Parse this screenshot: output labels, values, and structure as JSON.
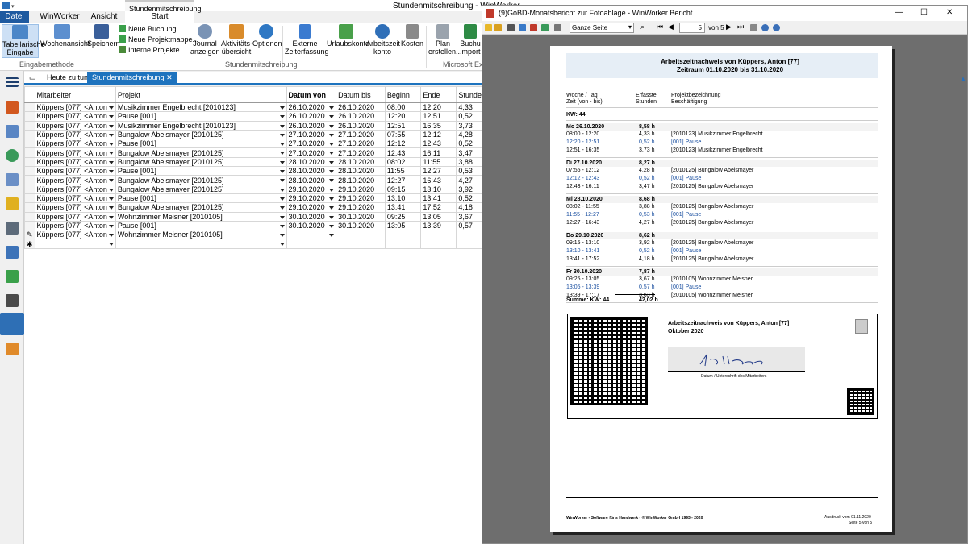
{
  "app": {
    "window_title": "Stundenmitschreibung - WinWorker",
    "context_group": "Stundenmitschreibung",
    "tabs": [
      "Datei",
      "WinWorker",
      "Ansicht",
      "Start"
    ]
  },
  "ribbon": {
    "buttons": {
      "tabellarische": "Tabellarische Eingabe",
      "wochenansicht": "Wochenansicht",
      "speichern": "Speichern",
      "neue_buchung": "Neue Buchung...",
      "neue_projektmappe": "Neue Projektmappe...",
      "interne_projekte": "Interne Projekte",
      "journal": "Journal anzeigen",
      "aktivitaeten": "Aktivitäts-übersicht",
      "optionen": "Optionen",
      "externe": "Externe Zeiterfassung",
      "urlaubskonto": "Urlaubskonto",
      "arbeitszeitkonto": "Arbeitszeit-konto",
      "kosten": "Kosten",
      "plan": "Plan erstellen...",
      "buchu": "Buchu import"
    },
    "groups": {
      "eingabemethode": "Eingabemethode",
      "stundenmitschreibung": "Stundenmitschreibung",
      "excel": "Microsoft Exc"
    }
  },
  "doc_tabs": [
    "Heute zu tun",
    "Stundenmitschreibung"
  ],
  "grid": {
    "columns": [
      "Mitarbeiter",
      "Projekt",
      "Datum von",
      "Datum bis",
      "Beginn",
      "Ende",
      "Stunde"
    ],
    "rows": [
      [
        "Küppers [077] <Anton",
        "Musikzimmer Engelbrecht [2010123]",
        "26.10.2020",
        "26.10.2020",
        "08:00",
        "12:20",
        "4,33"
      ],
      [
        "Küppers [077] <Anton",
        "Pause [001]",
        "26.10.2020",
        "26.10.2020",
        "12:20",
        "12:51",
        "0,52"
      ],
      [
        "Küppers [077] <Anton",
        "Musikzimmer Engelbrecht [2010123]",
        "26.10.2020",
        "26.10.2020",
        "12:51",
        "16:35",
        "3,73"
      ],
      [
        "Küppers [077] <Anton",
        "Bungalow Abelsmayer [2010125]",
        "27.10.2020",
        "27.10.2020",
        "07:55",
        "12:12",
        "4,28"
      ],
      [
        "Küppers [077] <Anton",
        "Pause [001]",
        "27.10.2020",
        "27.10.2020",
        "12:12",
        "12:43",
        "0,52"
      ],
      [
        "Küppers [077] <Anton",
        "Bungalow Abelsmayer [2010125]",
        "27.10.2020",
        "27.10.2020",
        "12:43",
        "16:11",
        "3,47"
      ],
      [
        "Küppers [077] <Anton",
        "Bungalow Abelsmayer [2010125]",
        "28.10.2020",
        "28.10.2020",
        "08:02",
        "11:55",
        "3,88"
      ],
      [
        "Küppers [077] <Anton",
        "Pause [001]",
        "28.10.2020",
        "28.10.2020",
        "11:55",
        "12:27",
        "0,53"
      ],
      [
        "Küppers [077] <Anton",
        "Bungalow Abelsmayer [2010125]",
        "28.10.2020",
        "28.10.2020",
        "12:27",
        "16:43",
        "4,27"
      ],
      [
        "Küppers [077] <Anton",
        "Bungalow Abelsmayer [2010125]",
        "29.10.2020",
        "29.10.2020",
        "09:15",
        "13:10",
        "3,92"
      ],
      [
        "Küppers [077] <Anton",
        "Pause [001]",
        "29.10.2020",
        "29.10.2020",
        "13:10",
        "13:41",
        "0,52"
      ],
      [
        "Küppers [077] <Anton",
        "Bungalow Abelsmayer [2010125]",
        "29.10.2020",
        "29.10.2020",
        "13:41",
        "17:52",
        "4,18"
      ],
      [
        "Küppers [077] <Anton",
        "Wohnzimmer Meisner [2010105]",
        "30.10.2020",
        "30.10.2020",
        "09:25",
        "13:05",
        "3,67"
      ],
      [
        "Küppers [077] <Anton",
        "Pause [001]",
        "30.10.2020",
        "30.10.2020",
        "13:05",
        "13:39",
        "0,57"
      ],
      [
        "Küppers [077] <Anton",
        "Wohnzimmer Meisner [2010105]",
        "",
        "",
        "",
        "",
        ""
      ]
    ]
  },
  "report_window": {
    "title": "(9)GoBD-Monatsbericht zur Fotoablage - WinWorker Bericht",
    "zoom": "Ganze Seite",
    "page_input": "5",
    "page_of": "von 5",
    "heading1": "Arbeitszeitnachweis von Küppers, Anton [77]",
    "heading2": "Zeitraum  01.10.2020  bis 31.10.2020",
    "col_woche": "Woche / Tag",
    "col_zeit": "Zeit (von - bis)",
    "col_erfasste": "Erfasste",
    "col_stunden": "Stunden",
    "col_projekt": "Projektbezeichnung",
    "col_besch": "Beschäftigung",
    "kw": "KW: 44",
    "days": [
      {
        "label": "Mo  26.10.2020",
        "total": "8,58 h",
        "entries": [
          {
            "time": "08:00 - 12:20",
            "hours": "4,33 h",
            "project": "[2010123] Musikzimmer Engelbrecht",
            "pause": false
          },
          {
            "time": "12:20 - 12:51",
            "hours": "0,52 h",
            "project": "[001] Pause",
            "pause": true
          },
          {
            "time": "12:51 - 16:35",
            "hours": "3,73 h",
            "project": "[2010123] Musikzimmer Engelbrecht",
            "pause": false
          }
        ]
      },
      {
        "label": "Di  27.10.2020",
        "total": "8,27 h",
        "entries": [
          {
            "time": "07:55 - 12:12",
            "hours": "4,28 h",
            "project": "[2010125] Bungalow Abelsmayer",
            "pause": false
          },
          {
            "time": "12:12 - 12:43",
            "hours": "0,52 h",
            "project": "[001] Pause",
            "pause": true
          },
          {
            "time": "12:43 - 16:11",
            "hours": "3,47 h",
            "project": "[2010125] Bungalow Abelsmayer",
            "pause": false
          }
        ]
      },
      {
        "label": "Mi  28.10.2020",
        "total": "8,68 h",
        "entries": [
          {
            "time": "08:02 - 11:55",
            "hours": "3,88 h",
            "project": "[2010125] Bungalow Abelsmayer",
            "pause": false
          },
          {
            "time": "11:55 - 12:27",
            "hours": "0,53 h",
            "project": "[001] Pause",
            "pause": true
          },
          {
            "time": "12:27 - 16:43",
            "hours": "4,27 h",
            "project": "[2010125] Bungalow Abelsmayer",
            "pause": false
          }
        ]
      },
      {
        "label": "Do  29.10.2020",
        "total": "8,62 h",
        "entries": [
          {
            "time": "09:15 - 13:10",
            "hours": "3,92 h",
            "project": "[2010125] Bungalow Abelsmayer",
            "pause": false
          },
          {
            "time": "13:10 - 13:41",
            "hours": "0,52 h",
            "project": "[001] Pause",
            "pause": true
          },
          {
            "time": "13:41 - 17:52",
            "hours": "4,18 h",
            "project": "[2010125] Bungalow Abelsmayer",
            "pause": false
          }
        ]
      },
      {
        "label": "Fr  30.10.2020",
        "total": "7,87 h",
        "entries": [
          {
            "time": "09:25 - 13:05",
            "hours": "3,67 h",
            "project": "[2010105] Wohnzimmer Meisner",
            "pause": false
          },
          {
            "time": "13:05 - 13:39",
            "hours": "0,57 h",
            "project": "[001] Pause",
            "pause": true
          },
          {
            "time": "13:39 - 17:17",
            "hours": "3,63 h",
            "project": "[2010105] Wohnzimmer Meisner",
            "pause": false
          }
        ]
      }
    ],
    "summe_label": "Summe: KW: 44",
    "summe_value": "42,02 h",
    "sig_title": "Arbeitszeitnachweis von Küppers, Anton [77]",
    "sig_month": "Oktober 2020",
    "sig_caption": "Datum / Unterschrift des Mitarbeiters",
    "footer_left": "WinWorker - Software für's Handwerk - © WinWorker GmbH 1993 - 2020",
    "footer_right1": "Ausdruck vom 01.11.2020",
    "footer_right2": "Seite 5 von 5"
  }
}
